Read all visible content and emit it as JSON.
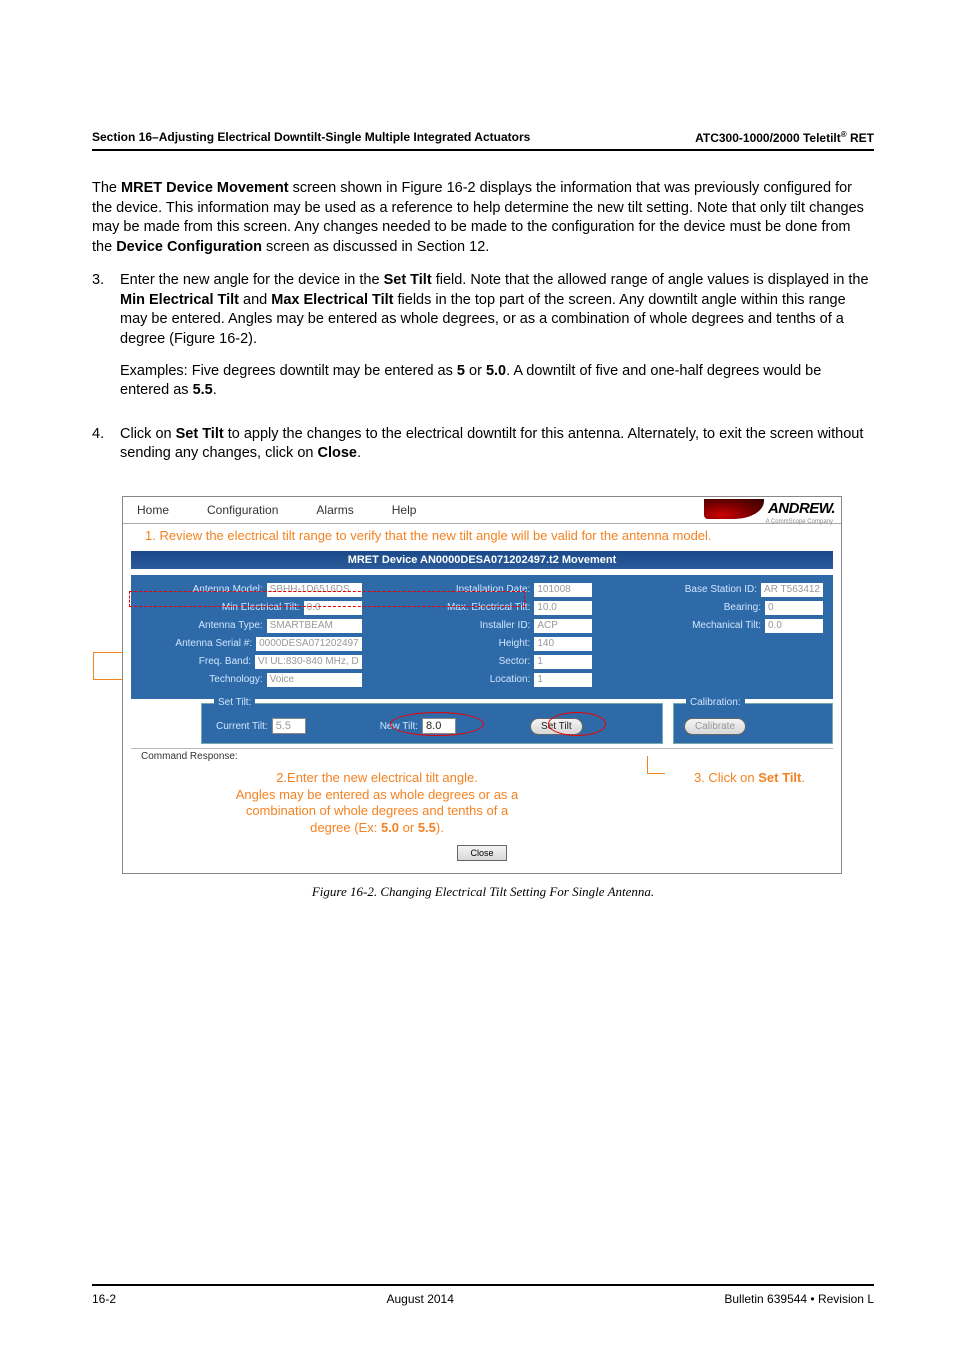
{
  "header": {
    "left": "Section 16–Adjusting Electrical Downtilt-Single Multiple Integrated Actuators",
    "right_prefix": "ATC300-1000/2000 Teletilt",
    "right_sup": "®",
    "right_suffix": " RET"
  },
  "paragraph1": {
    "t1": "The ",
    "b1": "MRET Device Movement",
    "t2": " screen shown in Figure 16-2 displays the information that was previously configured for the device. This information may be used as a reference to help determine the new tilt setting. Note that only tilt changes may be made from this screen. Any changes needed to be made to the configuration for the device must be done from the ",
    "b2": "Device Configuration",
    "t3": " screen as discussed in Section 12."
  },
  "step3": {
    "num": "3.",
    "t1": "Enter the new angle for the device in the ",
    "b1": "Set Tilt",
    "t2": " field. Note that the allowed range of angle values is displayed in the ",
    "b2": "Min Electrical Tilt",
    "t3": " and ",
    "b3": "Max Electrical Tilt",
    "t4": " fields in the top part of the screen. Any downtilt angle within this range may be entered. Angles may be entered as whole degrees, or as a combination of whole degrees and tenths of a degree (Figure 16-2).",
    "ex_t1": "Examples: Five degrees downtilt may be entered as ",
    "ex_b1": "5",
    "ex_t2": " or ",
    "ex_b2": "5.0",
    "ex_t3": ". A downtilt of five and one-half degrees would be entered as ",
    "ex_b3": "5.5",
    "ex_t4": "."
  },
  "step4": {
    "num": "4.",
    "t1": "Click on ",
    "b1": "Set Tilt",
    "t2": " to apply the changes to the electrical downtilt for this antenna. Alternately, to exit the screen without sending any changes, click on ",
    "b2": "Close",
    "t3": "."
  },
  "app": {
    "menu": {
      "home": "Home",
      "config": "Configuration",
      "alarms": "Alarms",
      "help": "Help"
    },
    "logo_text": "ANDREW.",
    "logo_sub": "A CommScope Company",
    "title_bar": "MRET Device AN0000DESA071202497.t2 Movement",
    "fields": {
      "antenna_model_l": "Antenna Model:",
      "antenna_model_v": "SBHH-1D6516DS",
      "install_date_l": "Installation Date:",
      "install_date_v": "101008",
      "base_station_l": "Base Station ID:",
      "base_station_v": "AR T563412",
      "min_tilt_l": "Min Electrical Tilt:",
      "min_tilt_v": "0.0",
      "max_tilt_l": "Max. Electrical Tilt:",
      "max_tilt_v": "10.0",
      "bearing_l": "Bearing:",
      "bearing_v": "0",
      "antenna_type_l": "Antenna Type:",
      "antenna_type_v": "SMARTBEAM",
      "installer_id_l": "Installer ID:",
      "installer_id_v": "ACP",
      "mech_tilt_l": "Mechanical Tilt:",
      "mech_tilt_v": "0.0",
      "antenna_serial_l": "Antenna Serial #:",
      "antenna_serial_v": "0000DESA071202497",
      "height_l": "Height:",
      "height_v": "140",
      "freq_band_l": "Freq. Band:",
      "freq_band_v": "VI  UL:830-840 MHz,  D",
      "sector_l": "Sector:",
      "sector_v": "1",
      "technology_l": "Technology:",
      "technology_v": "Voice",
      "location_l": "Location:",
      "location_v": "1"
    },
    "set_tilt": {
      "legend": "Set Tilt:",
      "current_l": "Current Tilt:",
      "current_v": "5.5",
      "new_l": "New Tilt:",
      "new_v": "8.0",
      "set_btn": "Set Tilt"
    },
    "calibration": {
      "legend": "Calibration:",
      "btn": "Calibrate"
    },
    "cmd_resp": "Command Response:",
    "close_btn": "Close"
  },
  "annotations": {
    "a1_num": "1.  ",
    "a1": "Review the electrical tilt range to verify that the new tilt angle will be valid for the antenna model.",
    "a2_l1": "2.Enter the new electrical tilt angle.",
    "a2_l2": "Angles may be entered as whole degrees or as a",
    "a2_l3": "combination of whole degrees and tenths of a",
    "a2_l4_pre": "degree (Ex: ",
    "a2_b1": "5.0",
    "a2_mid": " or ",
    "a2_b2": "5.5",
    "a2_l4_post": ").",
    "a3_pre": "3. Click on ",
    "a3_b": "Set Tilt",
    "a3_post": "."
  },
  "caption": "Figure 16-2.  Changing Electrical Tilt Setting For Single Antenna.",
  "footer": {
    "left": "16-2",
    "center": "August 2014",
    "right": "Bulletin 639544  •  Revision L"
  }
}
